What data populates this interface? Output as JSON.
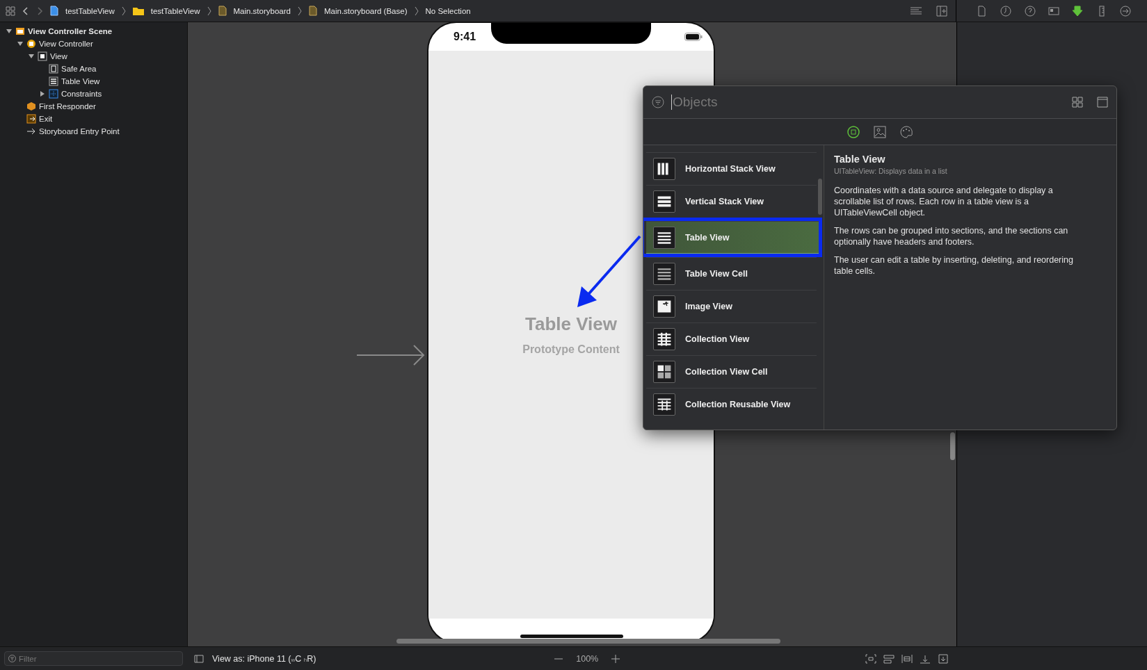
{
  "breadcrumbs": [
    {
      "kind": "file",
      "label": "testTableView"
    },
    {
      "kind": "folder",
      "label": "testTableView"
    },
    {
      "kind": "storyboard",
      "label": "Main.storyboard"
    },
    {
      "kind": "storyboard",
      "label": "Main.storyboard (Base)"
    },
    {
      "kind": "none",
      "label": "No Selection"
    }
  ],
  "outline": [
    {
      "kind": "scene",
      "label": "View Controller Scene",
      "expanded": true,
      "children": [
        {
          "kind": "controller",
          "label": "View Controller",
          "expanded": true,
          "children": [
            {
              "kind": "view",
              "label": "View",
              "expanded": true,
              "children": [
                {
                  "kind": "safe",
                  "label": "Safe Area"
                },
                {
                  "kind": "table",
                  "label": "Table View"
                },
                {
                  "kind": "constraints",
                  "label": "Constraints",
                  "expanded": false
                }
              ]
            }
          ]
        },
        {
          "kind": "responder",
          "label": "First Responder"
        },
        {
          "kind": "exit",
          "label": "Exit"
        },
        {
          "kind": "entry",
          "label": "Storyboard Entry Point"
        }
      ]
    }
  ],
  "inspector_tabs": [
    {
      "kind": "file",
      "selected": false
    },
    {
      "kind": "history",
      "selected": false
    },
    {
      "kind": "help",
      "selected": false
    },
    {
      "kind": "identity",
      "selected": false
    },
    {
      "kind": "attributes",
      "selected": true
    },
    {
      "kind": "size",
      "selected": false
    },
    {
      "kind": "connections",
      "selected": false
    }
  ],
  "phone": {
    "time": "9:41",
    "title": "Table View",
    "subtitle": "Prototype Content"
  },
  "library": {
    "placeholder": "Objects",
    "tabs": [
      {
        "kind": "objects",
        "selected": true
      },
      {
        "kind": "media",
        "selected": false
      },
      {
        "kind": "colors",
        "selected": false
      }
    ],
    "items": [
      {
        "kind": "hstack",
        "label": "Horizontal Stack View",
        "selected": false
      },
      {
        "kind": "vstack",
        "label": "Vertical Stack View",
        "selected": false
      },
      {
        "kind": "table",
        "label": "Table View",
        "selected": true
      },
      {
        "kind": "cell",
        "label": "Table View Cell",
        "selected": false
      },
      {
        "kind": "image",
        "label": "Image View",
        "selected": false
      },
      {
        "kind": "collection",
        "label": "Collection View",
        "selected": false
      },
      {
        "kind": "collectioncell",
        "label": "Collection View Cell",
        "selected": false
      },
      {
        "kind": "reusable",
        "label": "Collection Reusable View",
        "selected": false
      }
    ],
    "detail": {
      "title": "Table View",
      "subtitle": "UITableView: Displays data in a list",
      "paragraphs": [
        "Coordinates with a data source and delegate to display a scrollable list of rows. Each row in a table view is a UITableViewCell object.",
        "The rows can be grouped into sections, and the sections can optionally have headers and footers.",
        "The user can edit a table by inserting, deleting, and reordering table cells."
      ]
    }
  },
  "bottom_bar": {
    "filter_placeholder": "Filter",
    "view_as": "View as: iPhone 11 ($_{w}$C $_{h}$R)",
    "zoom": "100%"
  }
}
